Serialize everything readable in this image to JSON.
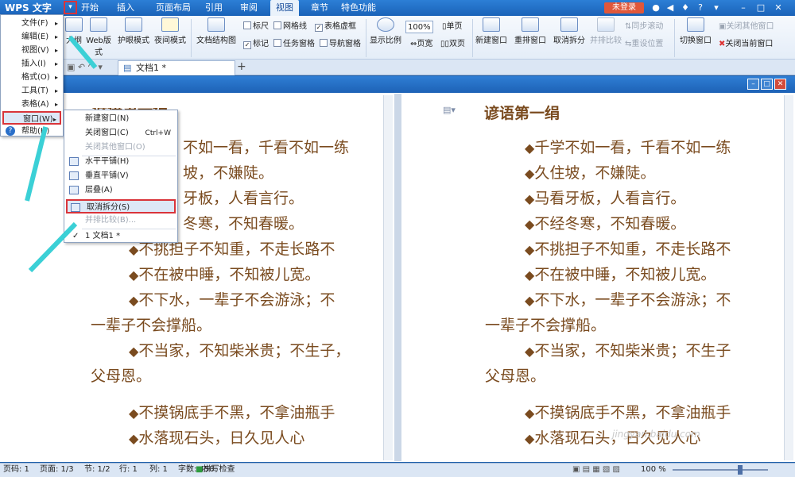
{
  "app": {
    "logo_text": "WPS 文字",
    "logo_dropdown_icon": "chevron-down-icon"
  },
  "ribbon_tabs": [
    {
      "label": "开始",
      "active": false
    },
    {
      "label": "插入",
      "active": false
    },
    {
      "label": "页面布局",
      "active": false
    },
    {
      "label": "引用",
      "active": false
    },
    {
      "label": "审阅",
      "active": false
    },
    {
      "label": "视图",
      "active": true
    },
    {
      "label": "章节",
      "active": false
    },
    {
      "label": "特色功能",
      "active": false
    }
  ],
  "titlebar": {
    "login_label": "未登录",
    "help_icon": "?"
  },
  "ribbon": {
    "outline": "大纲",
    "web_layout": "Web版式",
    "eye_protection": "护眼模式",
    "night_mode": "夜间模式",
    "doc_structure": "文档结构图",
    "ruler": "标尺",
    "gridlines": "网格线",
    "table_gridlines": "表格虚框",
    "marks": "标记",
    "task_pane": "任务窗格",
    "navigation_pane": "导航窗格",
    "zoom": "显示比例",
    "zoom_100": "100%",
    "page_width": "页宽",
    "single_page": "单页",
    "two_pages": "双页",
    "new_window": "新建窗口",
    "rearrange_window": "重排窗口",
    "cancel_split": "取消拆分",
    "side_by_side": "并排比较",
    "sync_scroll": "同步滚动",
    "reset_position": "重设位置",
    "switch_window": "切换窗口",
    "close_other_windows": "关闭其他窗口",
    "close_current_window": "关闭当前窗口"
  },
  "tabstrip": {
    "doc_tab": "文档1 *",
    "add_tab": "+"
  },
  "main_menu": [
    {
      "label": "文件(F)"
    },
    {
      "label": "编辑(E)"
    },
    {
      "label": "视图(V)"
    },
    {
      "label": "插入(I)"
    },
    {
      "label": "格式(O)"
    },
    {
      "label": "工具(T)"
    },
    {
      "label": "表格(A)"
    },
    {
      "label": "窗口(W)"
    },
    {
      "label": "帮助(H)"
    }
  ],
  "window_submenu": [
    {
      "label": "新建窗口(N)",
      "shortcut": "",
      "disabled": false
    },
    {
      "label": "关闭窗口(C)",
      "shortcut": "Ctrl+W",
      "disabled": false
    },
    {
      "label": "关闭其他窗口(O)",
      "shortcut": "",
      "disabled": true
    },
    {
      "label": "水平平铺(H)",
      "shortcut": "",
      "disabled": false
    },
    {
      "label": "垂直平铺(V)",
      "shortcut": "",
      "disabled": false
    },
    {
      "label": "层叠(A)",
      "shortcut": "",
      "disabled": false
    },
    {
      "label": "取消拆分(S)",
      "shortcut": "",
      "disabled": false
    },
    {
      "label": "并排比较(B)...",
      "shortcut": "",
      "disabled": true
    },
    {
      "label": "1 文档1 *",
      "shortcut": "",
      "disabled": false
    }
  ],
  "document": {
    "title": "谚语第一绢",
    "left_title_fragment": "谚语第一绢",
    "lines": [
      "千学不如一看，千看不如一练",
      "久住坡，不嫌陡。",
      "马看牙板，人看言行。",
      "不经冬寒，不知春暖。",
      "不挑担子不知重，不走长路不",
      "不在被中睡，不知被儿宽。",
      "不下水，一辈子不会游泳；不",
      "一辈子不会撑船。",
      "不当家，不知柴米贵；不生子",
      "父母恩。",
      "不摸锅底手不黑，不拿油瓶手",
      "水落现石头，日久见人心"
    ],
    "left_lines": [
      "不如一看，千看不如一练",
      "坡，不嫌陡。",
      "牙板，人看言行。",
      "冬寒，不知春暖。",
      "不挑担子不知重，不走长路不",
      "不在被中睡，不知被儿宽。",
      "不下水，一辈子不会游泳；不",
      "一辈子不会撑船。",
      "不当家，不知柴米贵；不生子，",
      "父母恩。",
      "不摸锅底手不黑，不拿油瓶手",
      "水落现石头，日久见人心"
    ]
  },
  "status": {
    "page_code": "页码: 1",
    "page": "页面: 1/3",
    "section": "节: 1/2",
    "row": "行: 1",
    "col": "列: 1",
    "word_count": "字数: 458",
    "spell_check": "拼写检查",
    "zoom": "100 %"
  },
  "watermark": "jingyan.baidu.com"
}
